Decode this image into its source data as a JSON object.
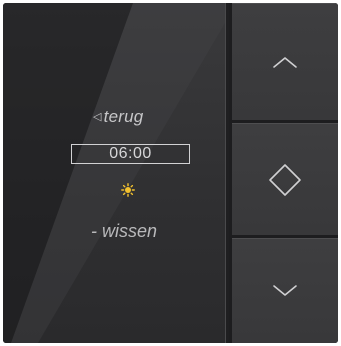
{
  "display": {
    "back_label": "terug",
    "time_value": "06:00",
    "clear_label": "- wissen",
    "mode_icon": "sun-icon",
    "mode_icon_color": "#f2c12e"
  },
  "keys": [
    {
      "name": "up",
      "icon": "chevron-up-icon"
    },
    {
      "name": "select",
      "icon": "diamond-icon"
    },
    {
      "name": "down",
      "icon": "chevron-down-icon"
    }
  ],
  "colors": {
    "panel": "#333335",
    "text": "#c7c7c9",
    "key": "#3b3b3d"
  }
}
